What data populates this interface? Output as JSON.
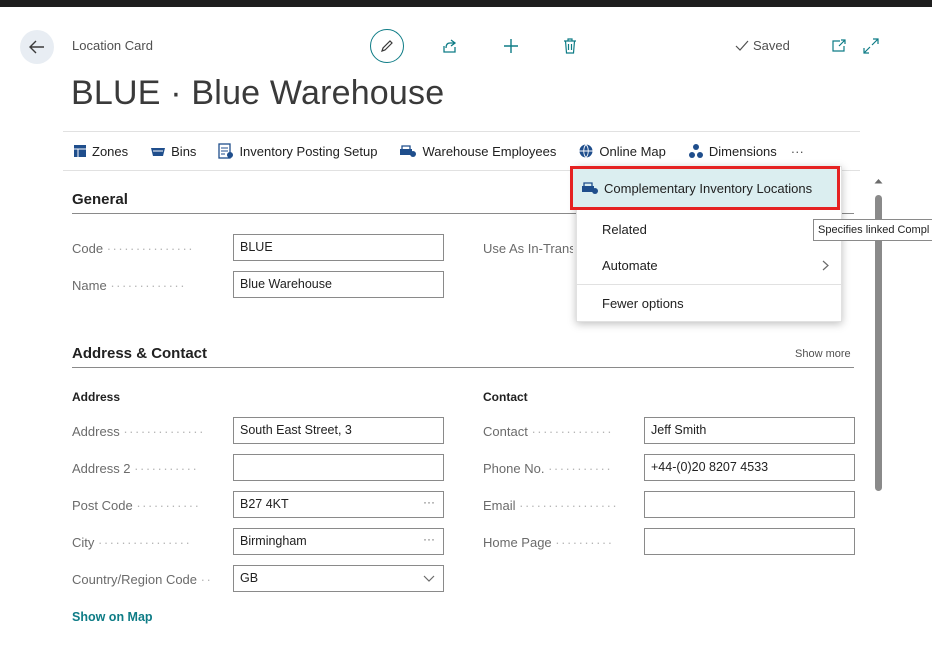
{
  "header": {
    "breadcrumb": "Location Card",
    "title": "BLUE · Blue Warehouse",
    "status": "Saved"
  },
  "actions": [
    {
      "label": "Zones",
      "icon": "zones-icon"
    },
    {
      "label": "Bins",
      "icon": "bins-icon"
    },
    {
      "label": "Inventory Posting Setup",
      "icon": "posting-setup-icon"
    },
    {
      "label": "Warehouse Employees",
      "icon": "warehouse-employees-icon"
    },
    {
      "label": "Online Map",
      "icon": "globe-icon"
    },
    {
      "label": "Dimensions",
      "icon": "dimensions-icon"
    }
  ],
  "more_label": "···",
  "menu": {
    "highlighted": "Complementary Inventory Locations",
    "related": "Related",
    "automate": "Automate",
    "fewer": "Fewer options",
    "tooltip": "Specifies linked Compl"
  },
  "general": {
    "title": "General",
    "code_label": "Code",
    "code_value": "BLUE",
    "name_label": "Name",
    "name_value": "Blue Warehouse",
    "in_transit_label": "Use As In-Trans"
  },
  "address_contact": {
    "title": "Address & Contact",
    "show_more": "Show more",
    "address_heading": "Address",
    "contact_heading": "Contact",
    "address_label": "Address",
    "address_value": "South East Street, 3",
    "address2_label": "Address 2",
    "address2_value": "",
    "post_code_label": "Post Code",
    "post_code_value": "B27 4KT",
    "city_label": "City",
    "city_value": "Birmingham",
    "country_label": "Country/Region Code",
    "country_value": "GB",
    "contact_label": "Contact",
    "contact_value": "Jeff Smith",
    "phone_label": "Phone No.",
    "phone_value": "+44-(0)20 8207 4533",
    "email_label": "Email",
    "email_value": "",
    "home_label": "Home Page",
    "home_value": "",
    "show_on_map": "Show on Map"
  },
  "colors": {
    "accent": "#0e7c86",
    "highlight_border": "#e52222",
    "highlight_fill": "#dbeef0"
  }
}
